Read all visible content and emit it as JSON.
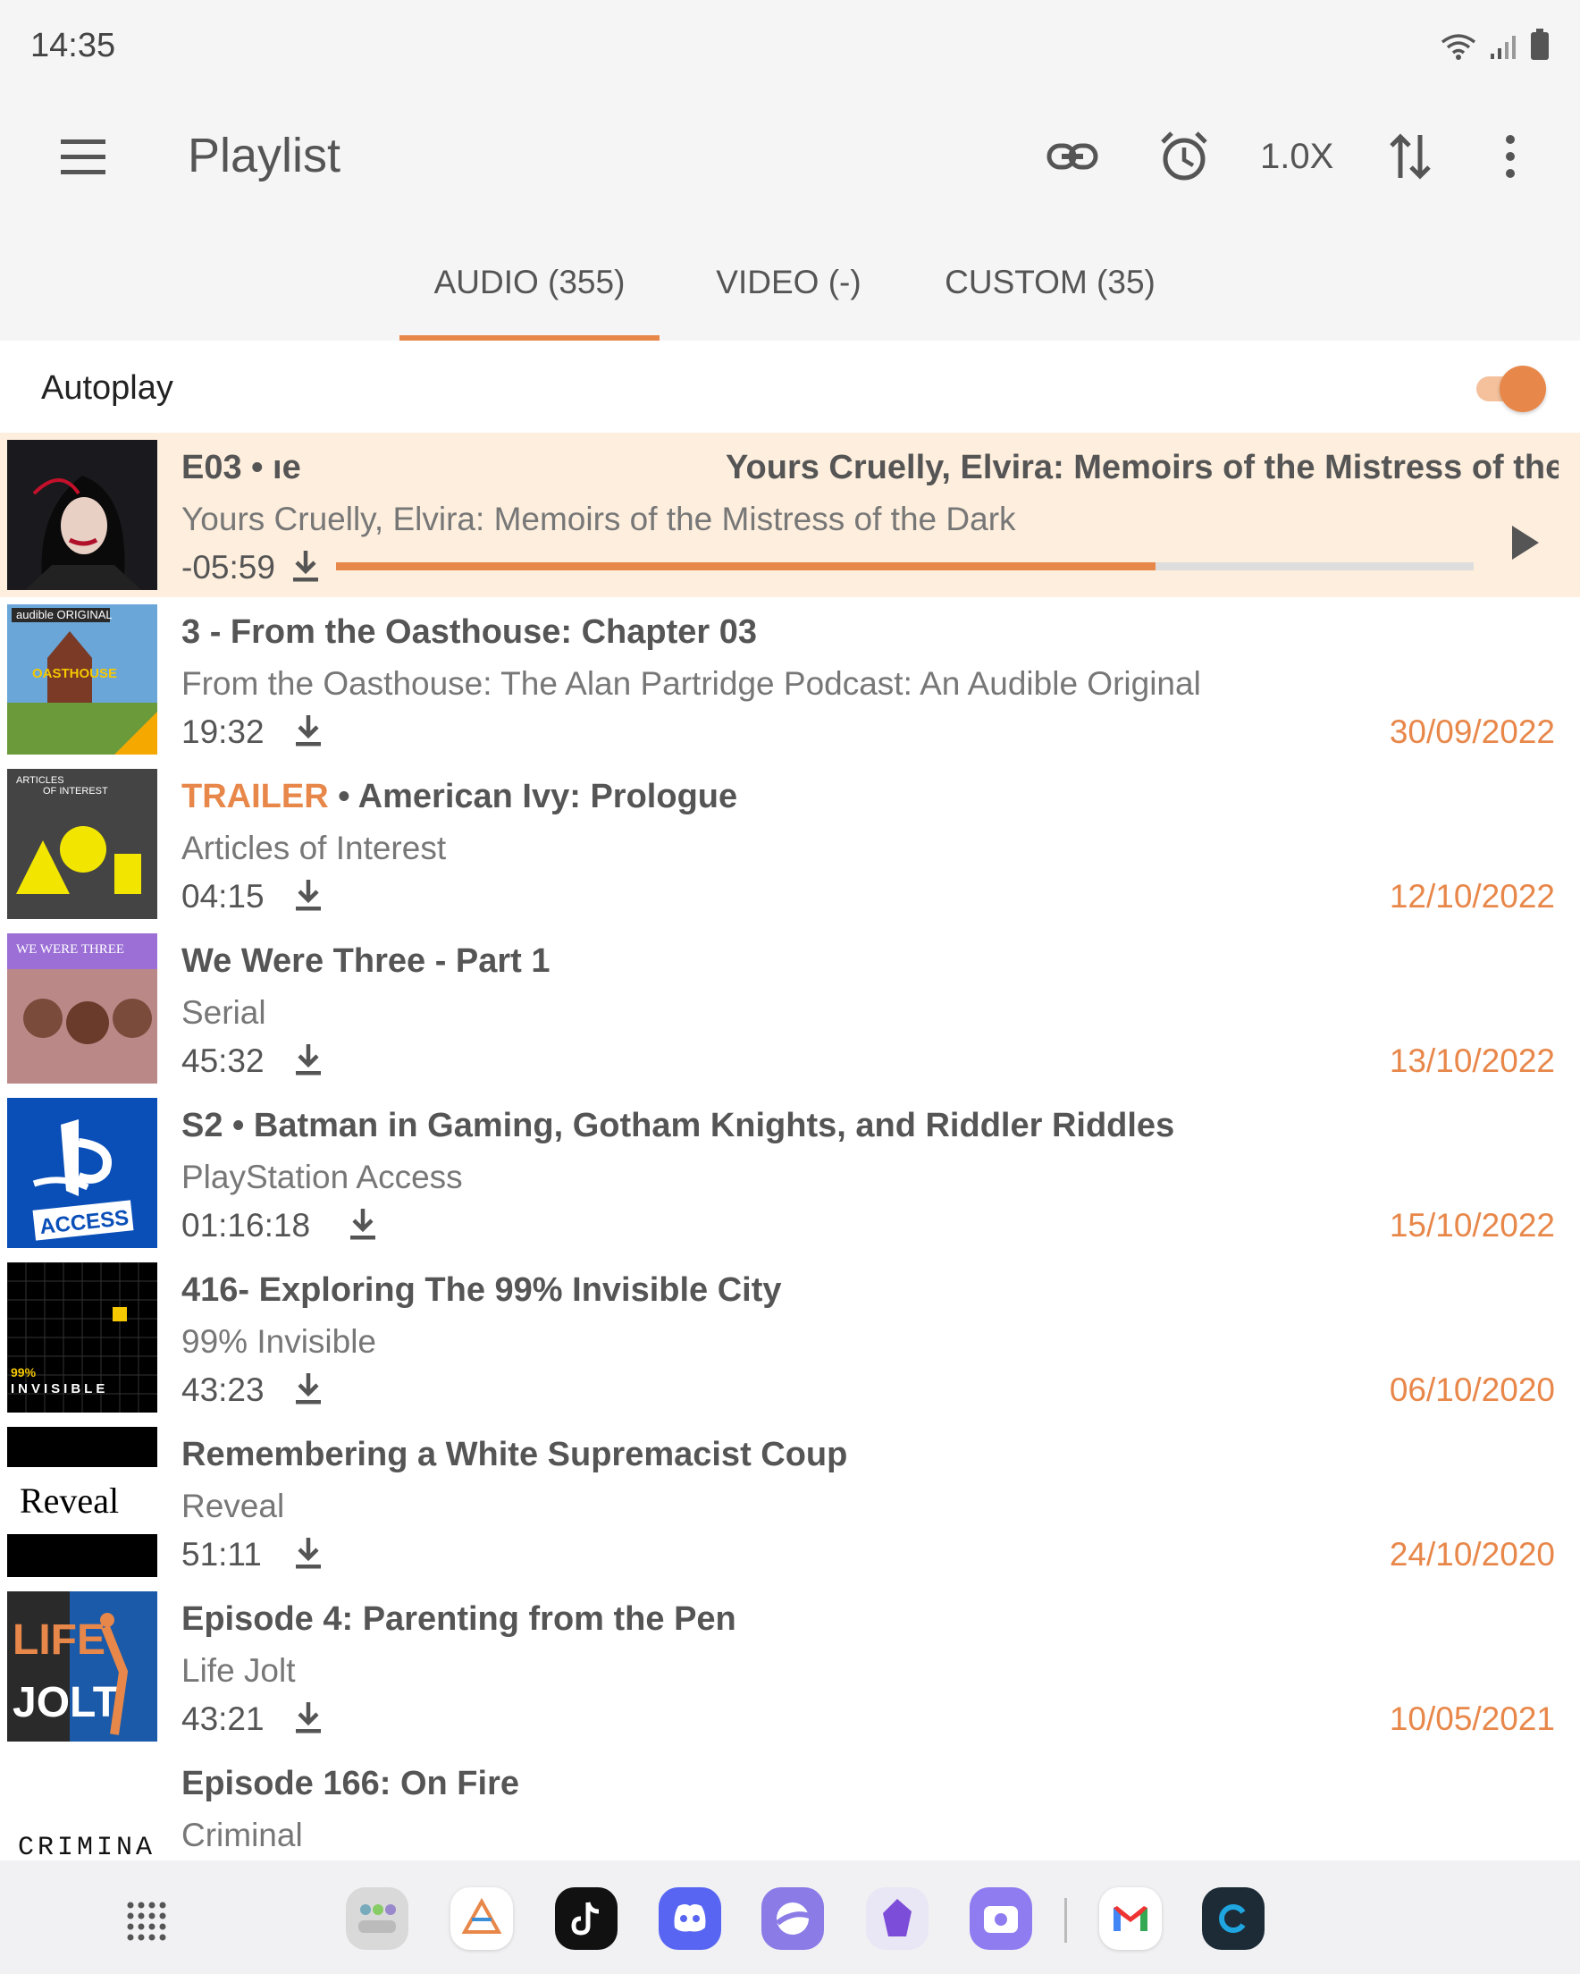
{
  "status": {
    "time": "14:35"
  },
  "app_bar": {
    "title": "Playlist",
    "speed": "1.0X"
  },
  "tabs": [
    {
      "label": "AUDIO (355)",
      "selected": true
    },
    {
      "label": "VIDEO (-)",
      "selected": false
    },
    {
      "label": "CUSTOM (35)",
      "selected": false
    }
  ],
  "autoplay": {
    "label": "Autoplay",
    "enabled": true
  },
  "now_playing": {
    "title_left": "E03 • ",
    "title_fragment": "ıe",
    "title_right": "Yours Cruelly, Elvira: Memoirs of the Mistress of the D",
    "podcast": "Yours Cruelly, Elvira: Memoirs of the Mistress of the Dark",
    "remaining": "-05:59",
    "progress": 0.72
  },
  "episodes": [
    {
      "prefix": "",
      "title": "3 - From the Oasthouse: Chapter 03",
      "podcast": "From the Oasthouse: The Alan Partridge Podcast: An Audible Original",
      "duration": "19:32",
      "date": "30/09/2022",
      "thumb_text": "audible ORIGINAL"
    },
    {
      "prefix": "TRAILER",
      "title": " • American Ivy: Prologue",
      "podcast": "Articles of Interest",
      "duration": "04:15",
      "date": "12/10/2022",
      "thumb_text": "ARTICLES OF INTEREST"
    },
    {
      "prefix": "",
      "title": "We Were Three - Part 1",
      "podcast": "Serial",
      "duration": "45:32",
      "date": "13/10/2022",
      "thumb_text": "WE WERE THREE"
    },
    {
      "prefix": "",
      "title": "S2 • Batman in Gaming, Gotham Knights, and Riddler Riddles",
      "podcast": "PlayStation Access",
      "duration": "01:16:18",
      "date": "15/10/2022",
      "thumb_text": "ACCESS"
    },
    {
      "prefix": "",
      "title": "416- Exploring The 99% Invisible City",
      "podcast": "99% Invisible",
      "duration": "43:23",
      "date": "06/10/2020",
      "thumb_text": "99% INVISIBLE"
    },
    {
      "prefix": "",
      "title": "Remembering a White Supremacist Coup",
      "podcast": "Reveal",
      "duration": "51:11",
      "date": "24/10/2020",
      "thumb_text": "Reveal"
    },
    {
      "prefix": "",
      "title": "Episode 4: Parenting from the Pen",
      "podcast": "Life Jolt",
      "duration": "43:21",
      "date": "10/05/2021",
      "thumb_text": "LIFE JOLT"
    },
    {
      "prefix": "",
      "title": "Episode 166: On Fire",
      "podcast": "Criminal",
      "duration": "",
      "date": "",
      "thumb_text": "CRIMINAL"
    }
  ],
  "dock": [
    {
      "name": "folder-apps-icon",
      "color": "#d9d9d9"
    },
    {
      "name": "app-triangle-icon",
      "color": "#ffffff"
    },
    {
      "name": "tiktok-icon",
      "color": "#111111"
    },
    {
      "name": "discord-icon",
      "color": "#5865f2"
    },
    {
      "name": "samsung-internet-icon",
      "color": "#8a7be6"
    },
    {
      "name": "obsidian-icon",
      "color": "#e9e6f5"
    },
    {
      "name": "screen-recorder-icon",
      "color": "#8f7cf0"
    },
    {
      "name": "gmail-icon",
      "color": "#ffffff"
    },
    {
      "name": "garmin-connect-icon",
      "color": "#1c2b36"
    }
  ],
  "colors": {
    "accent": "#e8874a",
    "playing_bg": "#fdeedd"
  }
}
